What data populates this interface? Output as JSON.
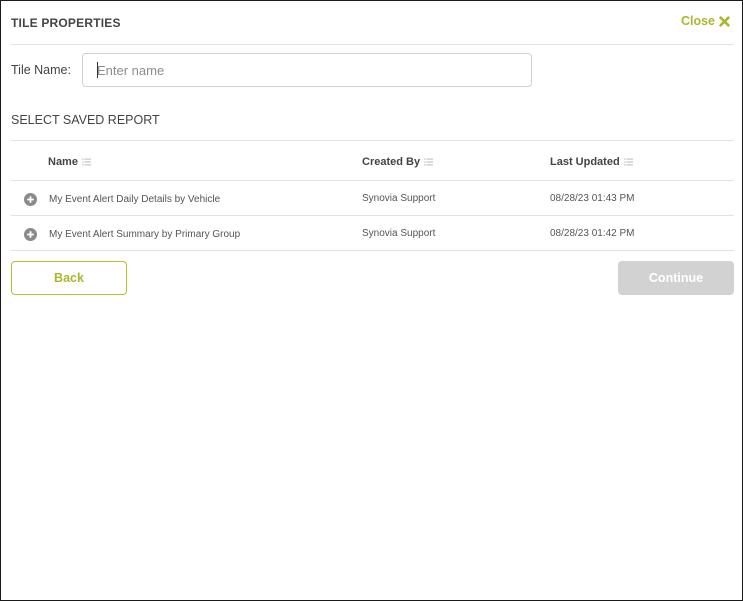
{
  "dialog": {
    "title": "TILE PROPERTIES",
    "close_label": "Close"
  },
  "form": {
    "tile_name_label": "Tile Name:",
    "tile_name_value": "",
    "tile_name_placeholder": "Enter name"
  },
  "section": {
    "label": "SELECT SAVED REPORT"
  },
  "table": {
    "headers": {
      "name": "Name",
      "created_by": "Created By",
      "last_updated": "Last Updated"
    },
    "rows": [
      {
        "name": "My Event Alert Daily Details by Vehicle",
        "created_by": "Synovia Support",
        "last_updated": "08/28/23 01:43 PM"
      },
      {
        "name": "My Event Alert Summary by Primary Group",
        "created_by": "Synovia Support",
        "last_updated": "08/28/23 01:42 PM"
      }
    ]
  },
  "buttons": {
    "back_label": "Back",
    "continue_label": "Continue"
  },
  "colors": {
    "accent": "#a9b82a",
    "disabled": "#d2d2d2",
    "divider": "#e2e2e2"
  },
  "icons": {
    "close": "close-x-icon",
    "sort": "sort-list-icon",
    "add": "plus-circle-icon"
  }
}
